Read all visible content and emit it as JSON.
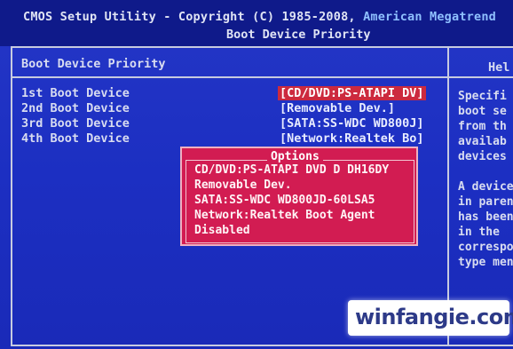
{
  "header": {
    "title": "CMOS Setup Utility - Copyright (C) 1985-2008,",
    "vendor": "American Megatrend",
    "subtitle": "Boot Device Priority"
  },
  "main": {
    "section_title": "Boot Device Priority",
    "rows": [
      {
        "label": "1st Boot Device",
        "value": "[CD/DVD:PS-ATAPI DV]"
      },
      {
        "label": "2nd Boot Device",
        "value": "[Removable Dev.]"
      },
      {
        "label": "3rd Boot Device",
        "value": "[SATA:SS-WDC WD800J]"
      },
      {
        "label": "4th Boot Device",
        "value": "[Network:Realtek Bo]"
      }
    ]
  },
  "options_popup": {
    "title": "Options",
    "items": [
      "CD/DVD:PS-ATAPI DVD D DH16DY",
      "Removable Dev.",
      "SATA:SS-WDC WD800JD-60LSA5",
      "Network:Realtek Boot Agent",
      "Disabled"
    ]
  },
  "help_panel": {
    "title": "Hel",
    "lines": [
      "Specifi",
      "boot se",
      "from th",
      "availab",
      "devices",
      "",
      "A device",
      "in paren",
      "has been",
      "in the",
      "correspo",
      "type men"
    ]
  },
  "watermark": {
    "text": "winfangie.com"
  },
  "colors": {
    "background": "#1c2fc2",
    "header_bar": "#0f1a8a",
    "selection": "#cc2a3e",
    "popup": "#d21c52",
    "vendor_text": "#8fc0ff"
  }
}
